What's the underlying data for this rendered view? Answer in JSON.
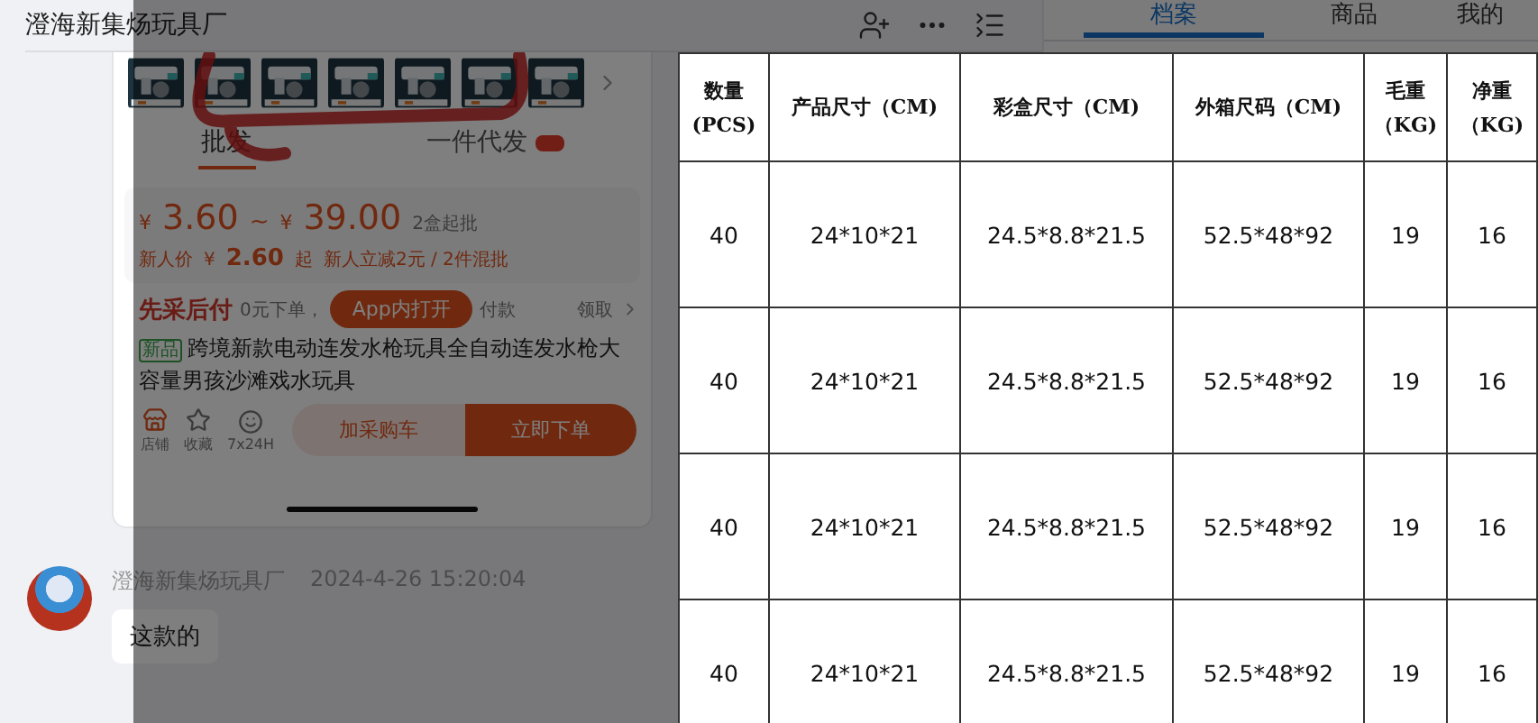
{
  "header": {
    "title": "澄海新集炀玩具厂"
  },
  "right_panel": {
    "tabs": [
      {
        "label": "档案",
        "selected": true
      },
      {
        "label": "商品",
        "selected": false
      },
      {
        "label": "我的",
        "selected": false
      }
    ]
  },
  "product_card": {
    "mode_tabs": [
      {
        "label": "批发",
        "selected": true
      },
      {
        "label": "一件代发",
        "selected": false
      }
    ],
    "currency": "¥",
    "price_low": "3.60",
    "range_sep": "~",
    "price_high": "39.00",
    "min_order": "2盒起批",
    "new_user_label": "新人价",
    "new_user_price": "2.60",
    "new_user_suffix": "起",
    "promo": "新人立减2元 / 2件混批",
    "pay_later": {
      "label": "先采后付",
      "text_before": "0元下单，",
      "text_after": "付款",
      "action": "领取"
    },
    "open_app_button": "App内打开",
    "tag": "新品",
    "title": "跨境新款电动连发水枪玩具全自动连发水枪大容量男孩沙滩戏水玩具",
    "actions": [
      {
        "kind": "store",
        "label": "店铺"
      },
      {
        "kind": "star",
        "label": "收藏"
      },
      {
        "kind": "service",
        "label": "7x24H"
      }
    ],
    "buttons": [
      {
        "kind": "secondary",
        "label": "加采购车"
      },
      {
        "kind": "primary",
        "label": "立即下单"
      }
    ]
  },
  "message": {
    "sender": "澄海新集炀玩具厂",
    "time": "2024-4-26 15:20:04",
    "text": "这款的"
  },
  "table": {
    "columns": [
      "数量(PCS)",
      "产品尺寸（CM)",
      "彩盒尺寸（CM)",
      "外箱尺码（CM)",
      "毛重（KG)",
      "净重（KG)"
    ],
    "rows": [
      [
        "40",
        "24*10*21",
        "24.5*8.8*21.5",
        "52.5*48*92",
        "19",
        "16"
      ],
      [
        "40",
        "24*10*21",
        "24.5*8.8*21.5",
        "52.5*48*92",
        "19",
        "16"
      ],
      [
        "40",
        "24*10*21",
        "24.5*8.8*21.5",
        "52.5*48*92",
        "19",
        "16"
      ],
      [
        "40",
        "24*10*21",
        "24.5*8.8*21.5",
        "52.5*48*92",
        "19",
        "16"
      ]
    ]
  }
}
